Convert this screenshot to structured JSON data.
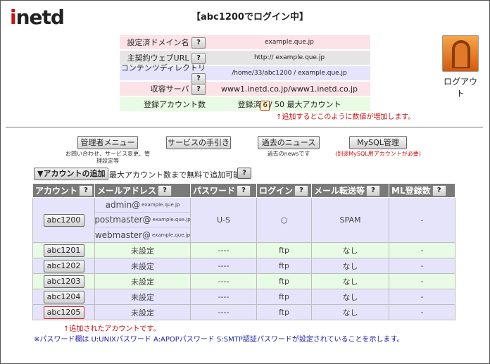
{
  "header": {
    "logo_first": "i",
    "logo_rest": "netd",
    "title": "【abc1200でログイン中】"
  },
  "info": {
    "rows": [
      {
        "label": "設定済ドメイン名",
        "value": "example.que.jp"
      },
      {
        "label": "主契約ウェブURL",
        "value": "http:// example.que.jp"
      },
      {
        "label": "コンテンツディレクトリ",
        "value": "/home/33/abc1200 / example.que.jp"
      },
      {
        "label": "収容サーバ",
        "value": "www1.inetd.co.jp/www1.inetd.co.jp"
      }
    ],
    "count_label": "登録アカウント数",
    "count_prefix": "登録済",
    "count_value": "6",
    "count_suffix": "/ 50 最大アカウント",
    "note": "↑追加するとこのように数値が増加します。",
    "help": "?"
  },
  "logout": {
    "label": "ログアウト"
  },
  "menu": {
    "admin": {
      "label": "管理者メニュー",
      "sub": "お問い合わせ、サービス変更、管理設定等"
    },
    "guide": {
      "label": "サービスの手引き"
    },
    "news": {
      "label": "過去のニュース",
      "sub": "過去のnewsです"
    },
    "mysql": {
      "label": "MySQL管理",
      "sub": "(別途MySQL用アカウントが必要)"
    }
  },
  "add": {
    "button": "▼アカウントの追加",
    "text": "最大アカウント数まで無料で追加可能"
  },
  "table": {
    "headers": [
      "アカウント",
      "メールアドレス",
      "パスワード",
      "ログイン",
      "メール転送等",
      "ML登録数"
    ],
    "first": {
      "account": "abc1200",
      "mails": [
        {
          "user": "admin@",
          "domain": "example.que.jp"
        },
        {
          "user": "postmaster@",
          "domain": "example.que.jp"
        },
        {
          "user": "webmaster@",
          "domain": "example.que.jp"
        }
      ],
      "password": "U-S",
      "login": "○",
      "forward": "SPAM",
      "ml": "-"
    },
    "rows": [
      {
        "account": "abc1201",
        "mail": "未設定",
        "password": "----",
        "login": "ftp",
        "forward": "なし",
        "ml": "-"
      },
      {
        "account": "abc1202",
        "mail": "未設定",
        "password": "----",
        "login": "ftp",
        "forward": "なし",
        "ml": "-"
      },
      {
        "account": "abc1203",
        "mail": "未設定",
        "password": "----",
        "login": "ftp",
        "forward": "なし",
        "ml": "-"
      },
      {
        "account": "abc1204",
        "mail": "未設定",
        "password": "----",
        "login": "ftp",
        "forward": "なし",
        "ml": "-"
      },
      {
        "account": "abc1205",
        "mail": "未設定",
        "password": "----",
        "login": "ftp",
        "forward": "なし",
        "ml": "-"
      }
    ]
  },
  "notes": {
    "added": "↑追加されたアカウントです。",
    "password": "※パスワード欄は U:UNIXパスワード A:APOPパスワード S:SMTP認証パスワードが設定されていることを示します。"
  },
  "colors": {
    "accent_red": "#cc1111",
    "header_gray": "#7a7a7a",
    "row_lavender": "#e6e4fb",
    "row_green": "#e8fbe4",
    "row_pink": "#fbe3e8"
  }
}
